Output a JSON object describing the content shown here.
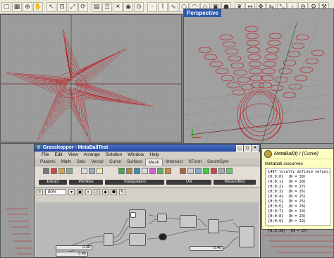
{
  "viewports": {
    "perspective_title": "Perspective"
  },
  "grasshopper": {
    "title": "Grasshopper - MetaBallTest",
    "menu": [
      "File",
      "Edit",
      "View",
      "Arrange",
      "Solution",
      "Window",
      "Help"
    ],
    "tabs": [
      "Params",
      "Math",
      "Sets",
      "Vector",
      "Curve",
      "Surface",
      "Mesh",
      "Intersect",
      "XForm",
      "GeomGym"
    ],
    "active_tab": "Mesh",
    "ribbon_groups": [
      "Extract",
      "Primitive",
      "Triangulation",
      "Util",
      "WeaverBird"
    ],
    "zoom": "80%",
    "sliders": [
      "0.40",
      "0.40",
      "0.40"
    ]
  },
  "tooltip": {
    "title": "MetaBall(t) I (Curve)",
    "subtitle": "Metaball isocurves",
    "panel_lines": [
      "1497 locally defined values.",
      "{0;0;0}  (N = 30)",
      "{0;0;1}  (N = 28)",
      "{0;0;2}  (N = 27)",
      "{0;0;3}  (N = 26)",
      "{0;0;4}  (N = 25)",
      "{0;0;5}  (N = 25)",
      "{0;0;6}  (N = 24)",
      "{0;0;7}  (N = 24)",
      "{0;0;8}  (N = 23)",
      "{0;0;9}  (N = 22)",
      "...",
      "{0;0;39}  (N = 27)"
    ]
  },
  "colors": {
    "curve_red": "#c0141c",
    "viewport_bg": "#9c9c9c",
    "title_blue": "#2f59a8",
    "tooltip_bg": "#ffffc4"
  }
}
